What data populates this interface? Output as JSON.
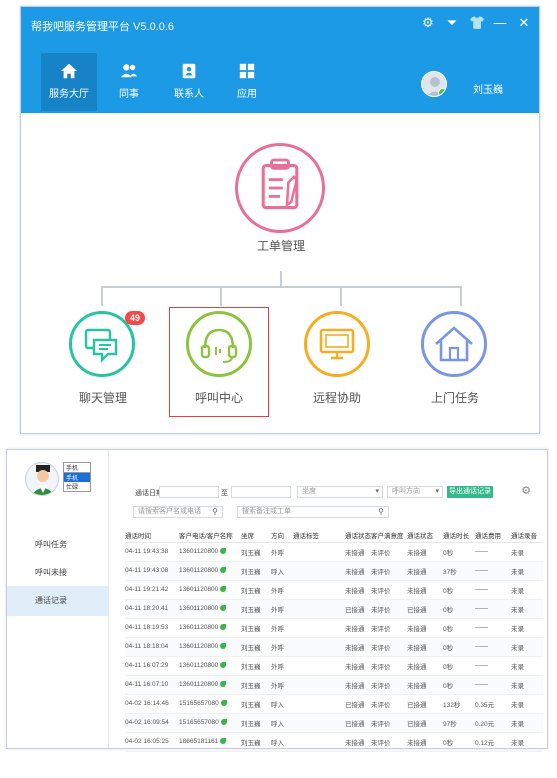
{
  "app": {
    "title": "帮我吧服务管理平台 V5.0.0.6"
  },
  "window_controls": [
    "⚙",
    "⏷",
    "👕",
    "—",
    "✕"
  ],
  "nav": {
    "tabs": [
      {
        "label": "服务大厅",
        "icon": "home-icon",
        "active": true
      },
      {
        "label": "同事",
        "icon": "colleagues-icon",
        "active": false
      },
      {
        "label": "联系人",
        "icon": "contacts-icon",
        "active": false
      },
      {
        "label": "应用",
        "icon": "apps-icon",
        "active": false
      }
    ]
  },
  "user": {
    "name": "刘玉巍",
    "status": "online"
  },
  "hub": {
    "center": {
      "label": "工单管理",
      "icon": "clipboard-icon",
      "color": "#ea6f97"
    },
    "children": [
      {
        "label": "聊天管理",
        "icon": "chat-icon",
        "color": "#27c4a2",
        "badge": "49"
      },
      {
        "label": "呼叫中心",
        "icon": "headset-icon",
        "color": "#8dc43f",
        "highlighted": true
      },
      {
        "label": "远程协助",
        "icon": "monitor-icon",
        "color": "#f5ae23"
      },
      {
        "label": "上门任务",
        "icon": "house-icon",
        "color": "#7b95e6"
      }
    ]
  },
  "callcenter": {
    "status_select": {
      "value": "手机",
      "options": [
        "手机",
        "接听",
        "忙碌"
      ]
    },
    "side_items": [
      {
        "label": "呼叫任务",
        "active": false
      },
      {
        "label": "呼叫未接",
        "active": false
      },
      {
        "label": "通话记录",
        "active": true
      }
    ],
    "filters": {
      "date_label": "通话日期",
      "date_sep": "至",
      "agent_select": "坐席",
      "type_select": "呼叫方向",
      "export_button": "导出通话记录",
      "search1_placeholder": "请搜索客户名或电话",
      "search2_placeholder": "搜索备注或工单"
    },
    "columns": [
      "通话时间",
      "客户电话/客户名称",
      "坐席",
      "方向",
      "通话标签",
      "通话状态",
      "客户满意度",
      "通话状态",
      "通话时长",
      "通话费用",
      "通话录音"
    ],
    "rows": [
      [
        "04-11 19:43:38",
        "13601120800",
        "刘玉巍",
        "外呼",
        "",
        "未接通",
        "未评价",
        "0秒",
        "——",
        "未录"
      ],
      [
        "04-11 19:43:08",
        "13601120800",
        "刘玉巍",
        "呼入",
        "",
        "未接通",
        "未评价",
        "37秒",
        "——",
        "未录"
      ],
      [
        "04-11 19:21:42",
        "13601120800",
        "刘玉巍",
        "外呼",
        "",
        "未接通",
        "未评价",
        "0秒",
        "——",
        "未录"
      ],
      [
        "04-11 18:20:41",
        "13601120800",
        "刘玉巍",
        "外呼",
        "",
        "已接通",
        "未评价",
        "0秒",
        "——",
        "未录"
      ],
      [
        "04-11 18:19:53",
        "13601120800",
        "刘玉巍",
        "外呼",
        "",
        "未接通",
        "未评价",
        "0秒",
        "——",
        "未录"
      ],
      [
        "04-11 18:18:04",
        "13601120800",
        "刘玉巍",
        "外呼",
        "",
        "未接通",
        "未评价",
        "0秒",
        "——",
        "未录"
      ],
      [
        "04-11 16:07:29",
        "13601120800",
        "刘玉巍",
        "外呼",
        "",
        "未接通",
        "未评价",
        "0秒",
        "——",
        "未录"
      ],
      [
        "04-11 16:07:10",
        "13601120800",
        "刘玉巍",
        "外呼",
        "",
        "未接通",
        "未评价",
        "0秒",
        "——",
        "未录"
      ],
      [
        "04-02 16:14:46",
        "15165657080",
        "刘玉巍",
        "呼入",
        "",
        "已接通",
        "未评价",
        "132秒",
        "0.35元",
        "未录"
      ],
      [
        "04-02 16:09:54",
        "15165657080",
        "刘玉巍",
        "呼入",
        "",
        "已接通",
        "未评价",
        "97秒",
        "0.20元",
        "未录"
      ],
      [
        "04-02 16:05:25",
        "18665181161",
        "刘玉巍",
        "呼入",
        "",
        "未接通",
        "未评价",
        "0秒",
        "0.12元",
        "未录"
      ]
    ]
  }
}
